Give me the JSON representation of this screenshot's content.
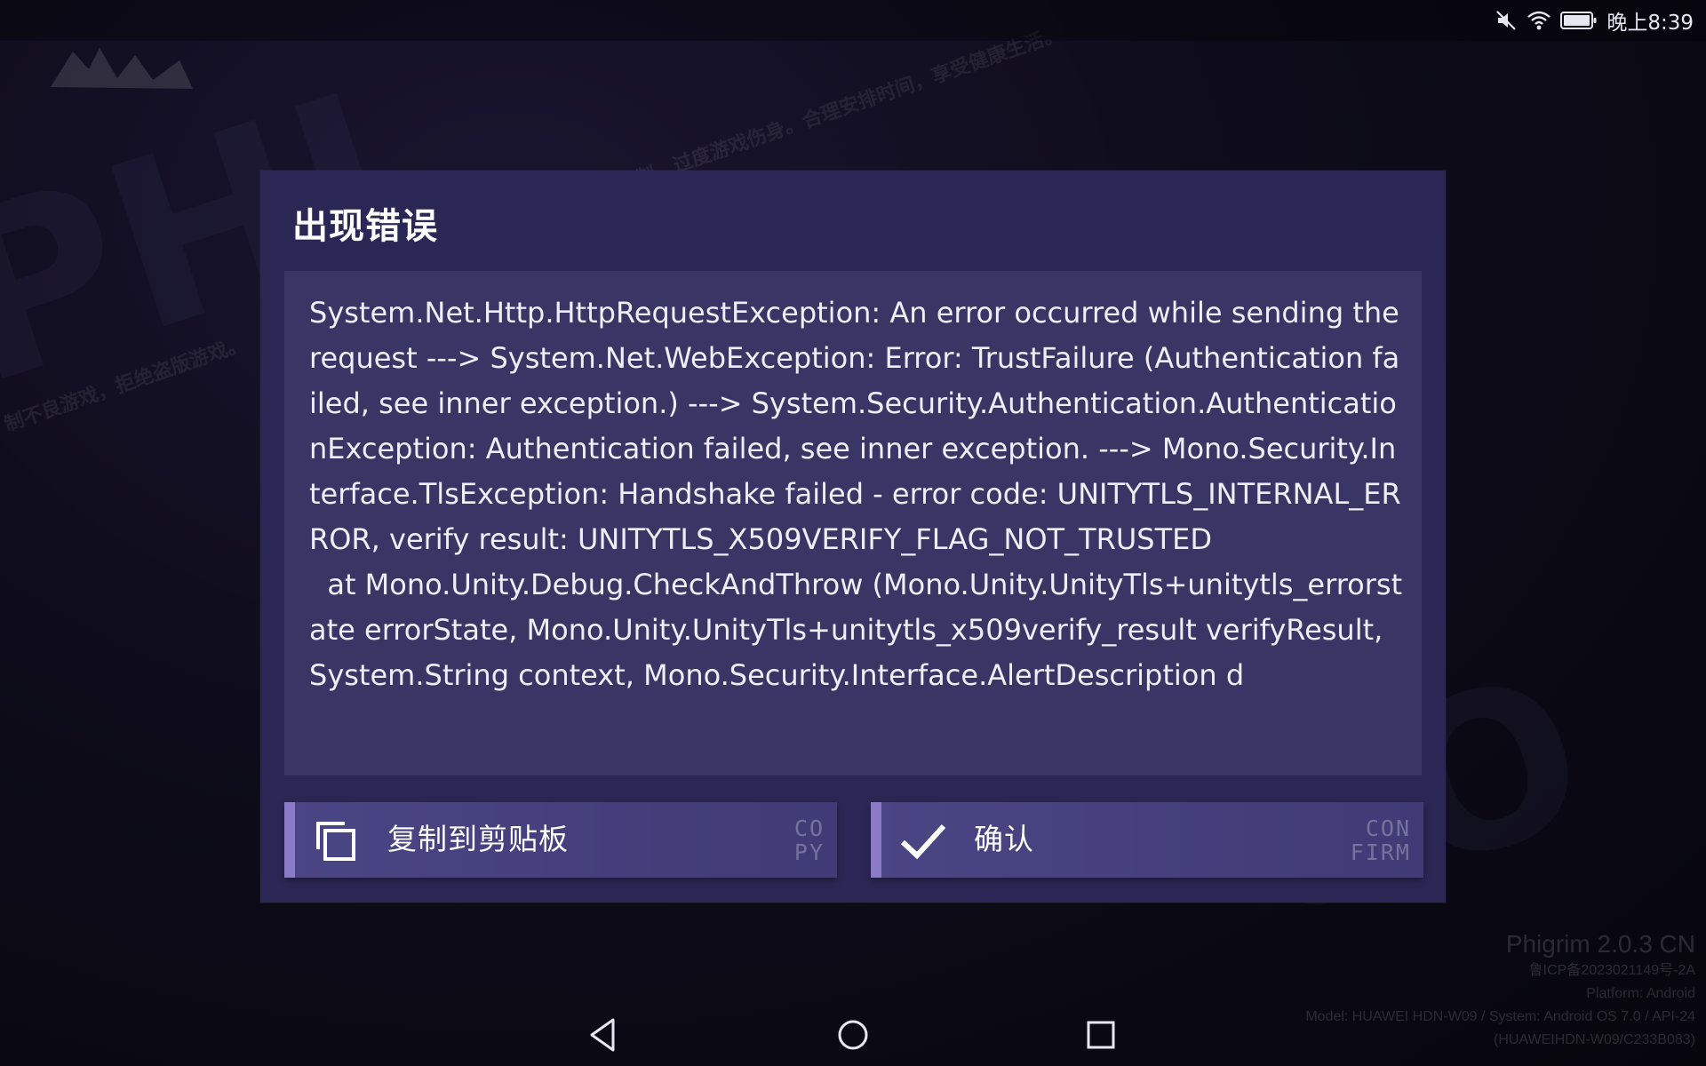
{
  "status_bar": {
    "time": "晚上8:39",
    "icons": [
      "mute-icon",
      "wifi-icon",
      "battery-icon"
    ]
  },
  "background": {
    "watermark_1": "制不良游戏，拒绝盗版游戏。",
    "watermark_2": "抵制，过度游戏伤身。合理安排时间，享受健康生活。",
    "logo": "game-logo"
  },
  "dialog": {
    "title": "出现错误",
    "message": "System.Net.Http.HttpRequestException: An error occurred while sending the request ---> System.Net.WebException: Error: TrustFailure (Authentication failed, see inner exception.) ---> System.Security.Authentication.AuthenticationException: Authentication failed, see inner exception. ---> Mono.Security.Interface.TlsException: Handshake failed - error code: UNITYTLS_INTERNAL_ERROR, verify result: UNITYTLS_X509VERIFY_FLAG_NOT_TRUSTED\n  at Mono.Unity.Debug.CheckAndThrow (Mono.Unity.UnityTls+unitytls_errorstate errorState, Mono.Unity.UnityTls+unitytls_x509verify_result verifyResult, System.String context, Mono.Security.Interface.AlertDescription d",
    "copy_button": {
      "label": "复制到剪贴板",
      "deco_line1": "CO",
      "deco_line2": "PY",
      "icon": "copy-icon"
    },
    "confirm_button": {
      "label": "确认",
      "deco_line1": "CON",
      "deco_line2": "FIRM",
      "icon": "checkmark-icon"
    }
  },
  "version_info": {
    "version": "Phigrim 2.0.3 CN",
    "icp": "鲁ICP备2023021149号-2A",
    "platform": "Platform: Android",
    "model": "Model: HUAWEI HDN-W09 / System: Android OS 7.0 / API-24",
    "build": "(HUAWEIHDN-W09/C233B083)"
  },
  "nav_bar": {
    "buttons": [
      "back-icon",
      "home-icon",
      "recents-icon"
    ]
  },
  "colors": {
    "dialog_bg": "#2b2755",
    "message_bg": "#393564",
    "button_bg": "#4a4584",
    "button_accent": "#8b7ac8"
  }
}
